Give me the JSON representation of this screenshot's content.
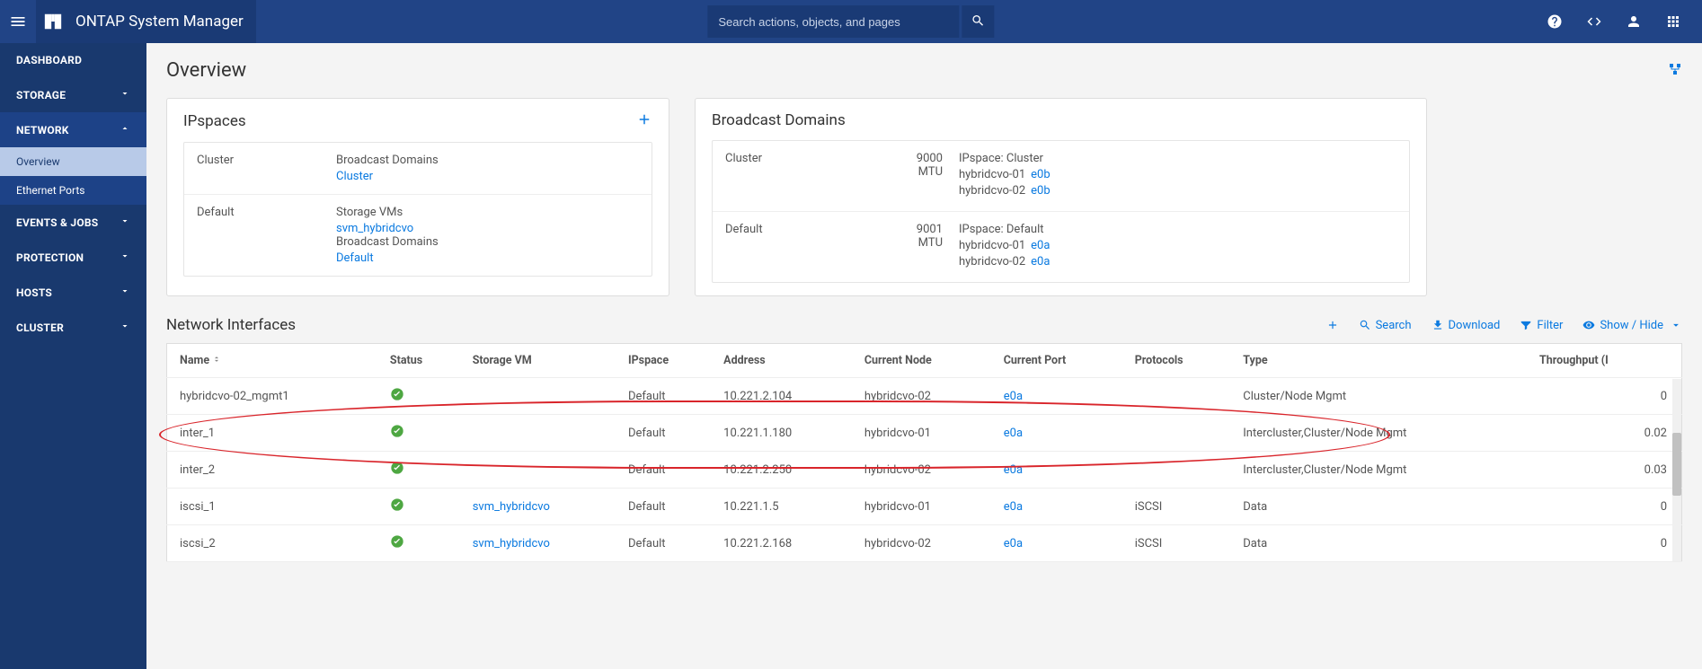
{
  "header": {
    "title": "ONTAP System Manager",
    "search_placeholder": "Search actions, objects, and pages"
  },
  "sidebar": {
    "items": [
      {
        "label": "DASHBOARD",
        "expandable": false
      },
      {
        "label": "STORAGE",
        "expandable": true,
        "expanded": false
      },
      {
        "label": "NETWORK",
        "expandable": true,
        "expanded": true,
        "children": [
          {
            "label": "Overview",
            "selected": true
          },
          {
            "label": "Ethernet Ports",
            "selected": false
          }
        ]
      },
      {
        "label": "EVENTS & JOBS",
        "expandable": true,
        "expanded": false
      },
      {
        "label": "PROTECTION",
        "expandable": true,
        "expanded": false
      },
      {
        "label": "HOSTS",
        "expandable": true,
        "expanded": false
      },
      {
        "label": "CLUSTER",
        "expandable": true,
        "expanded": false
      }
    ]
  },
  "page": {
    "title": "Overview"
  },
  "ipspaces": {
    "title": "IPspaces",
    "rows": [
      {
        "name": "Cluster",
        "blocks": [
          {
            "label": "Broadcast Domains",
            "link": "Cluster"
          }
        ]
      },
      {
        "name": "Default",
        "blocks": [
          {
            "label": "Storage VMs",
            "link": "svm_hybridcvo"
          },
          {
            "label": "Broadcast Domains",
            "link": "Default"
          }
        ]
      }
    ]
  },
  "broadcast_domains": {
    "title": "Broadcast Domains",
    "rows": [
      {
        "name": "Cluster",
        "mtu": "9000 MTU",
        "ipspace": "IPspace: Cluster",
        "nodes": [
          {
            "node": "hybridcvo-01",
            "port": "e0b"
          },
          {
            "node": "hybridcvo-02",
            "port": "e0b"
          }
        ]
      },
      {
        "name": "Default",
        "mtu": "9001 MTU",
        "ipspace": "IPspace: Default",
        "nodes": [
          {
            "node": "hybridcvo-01",
            "port": "e0a"
          },
          {
            "node": "hybridcvo-02",
            "port": "e0a"
          }
        ]
      }
    ]
  },
  "network_interfaces": {
    "title": "Network Interfaces",
    "actions": {
      "search": "Search",
      "download": "Download",
      "filter": "Filter",
      "showhide": "Show / Hide"
    },
    "columns": {
      "name": "Name",
      "status": "Status",
      "svm": "Storage VM",
      "ipspace": "IPspace",
      "address": "Address",
      "curnode": "Current Node",
      "curport": "Current Port",
      "protocols": "Protocols",
      "type": "Type",
      "throughput": "Throughput (I"
    },
    "rows": [
      {
        "name": "hybridcvo-02_mgmt1",
        "status": "ok",
        "svm": "",
        "ipspace": "Default",
        "address": "10.221.2.104",
        "curnode": "hybridcvo-02",
        "curport": "e0a",
        "protocols": "",
        "type": "Cluster/Node Mgmt",
        "throughput": "0"
      },
      {
        "name": "inter_1",
        "status": "ok",
        "svm": "",
        "ipspace": "Default",
        "address": "10.221.1.180",
        "curnode": "hybridcvo-01",
        "curport": "e0a",
        "protocols": "",
        "type": "Intercluster,Cluster/Node Mgmt",
        "throughput": "0.02"
      },
      {
        "name": "inter_2",
        "status": "ok",
        "svm": "",
        "ipspace": "Default",
        "address": "10.221.2.250",
        "curnode": "hybridcvo-02",
        "curport": "e0a",
        "protocols": "",
        "type": "Intercluster,Cluster/Node Mgmt",
        "throughput": "0.03"
      },
      {
        "name": "iscsi_1",
        "status": "ok",
        "svm": "svm_hybridcvo",
        "ipspace": "Default",
        "address": "10.221.1.5",
        "curnode": "hybridcvo-01",
        "curport": "e0a",
        "protocols": "iSCSI",
        "type": "Data",
        "throughput": "0"
      },
      {
        "name": "iscsi_2",
        "status": "ok",
        "svm": "svm_hybridcvo",
        "ipspace": "Default",
        "address": "10.221.2.168",
        "curnode": "hybridcvo-02",
        "curport": "e0a",
        "protocols": "iSCSI",
        "type": "Data",
        "throughput": "0"
      }
    ]
  }
}
